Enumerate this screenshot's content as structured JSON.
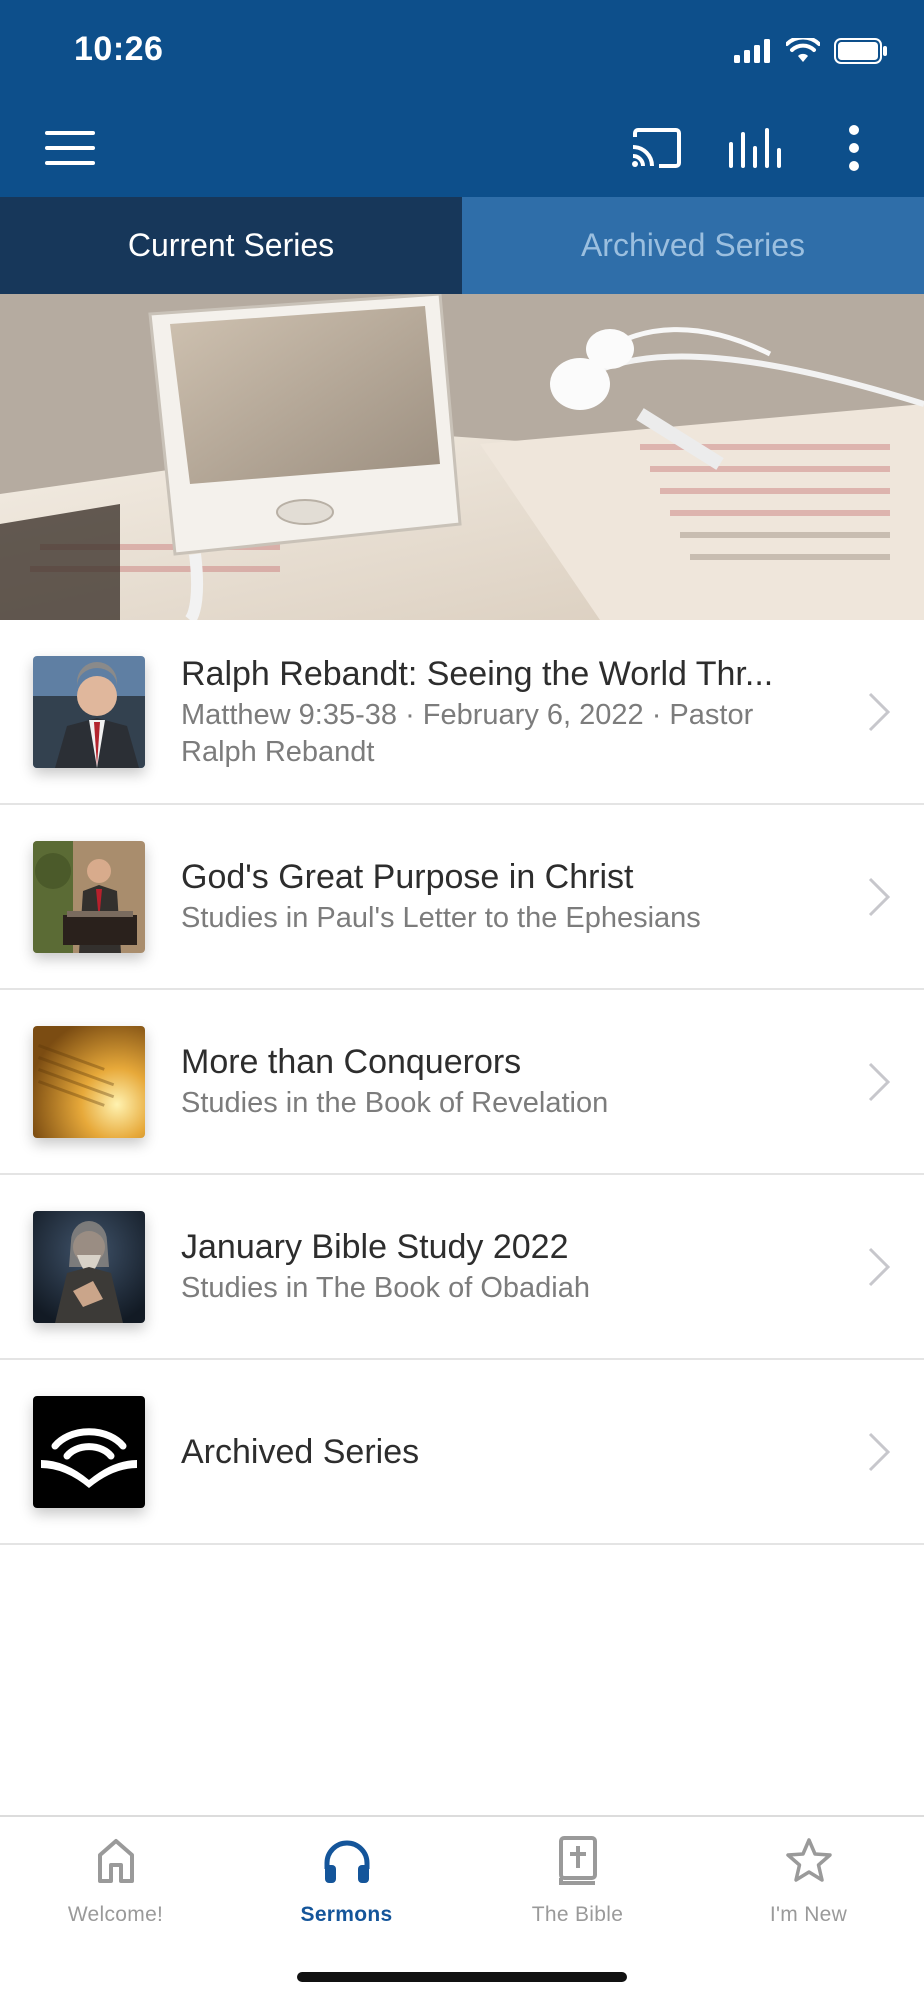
{
  "status_bar": {
    "time": "10:26"
  },
  "toolbar": {
    "menu_icon": "hamburger-menu-icon",
    "cast_icon": "cast-icon",
    "audio_icon": "audio-bars-icon",
    "more_icon": "more-vertical-icon"
  },
  "tabs": [
    {
      "label": "Current Series",
      "active": true
    },
    {
      "label": "Archived Series",
      "active": false
    }
  ],
  "series": [
    {
      "title": "Ralph Rebandt: Seeing the World Thr...",
      "subtitle": "Matthew 9:35-38 · February 6, 2022 · Pastor Ralph Rebandt"
    },
    {
      "title": "God's Great Purpose in Christ",
      "subtitle": "Studies in Paul's Letter to the Ephesians"
    },
    {
      "title": "More than Conquerors",
      "subtitle": "Studies in the Book of Revelation"
    },
    {
      "title": "January Bible Study 2022",
      "subtitle": "Studies in The Book of Obadiah"
    },
    {
      "title": "Archived Series",
      "subtitle": ""
    }
  ],
  "tabbar": [
    {
      "label": "Welcome!",
      "icon": "home-icon"
    },
    {
      "label": "Sermons",
      "icon": "headphones-icon",
      "active": true
    },
    {
      "label": "The Bible",
      "icon": "bible-icon"
    },
    {
      "label": "I'm New",
      "icon": "star-icon"
    }
  ],
  "colors": {
    "header": "#0d4f8b",
    "tab_active": "#17375a",
    "tab_inactive": "#2f6ea9",
    "accent": "#14559a"
  }
}
